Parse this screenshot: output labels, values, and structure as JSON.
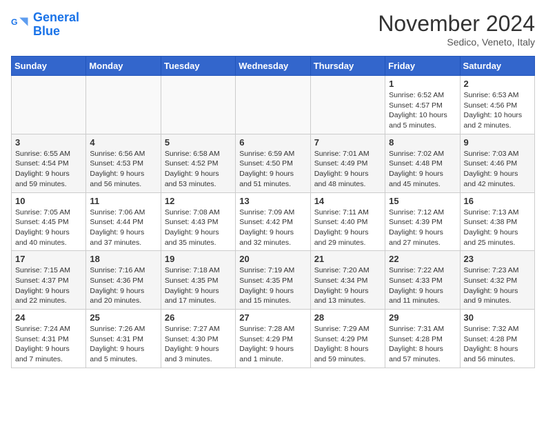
{
  "logo": {
    "line1": "General",
    "line2": "Blue"
  },
  "title": "November 2024",
  "location": "Sedico, Veneto, Italy",
  "headers": [
    "Sunday",
    "Monday",
    "Tuesday",
    "Wednesday",
    "Thursday",
    "Friday",
    "Saturday"
  ],
  "weeks": [
    [
      {
        "day": "",
        "info": ""
      },
      {
        "day": "",
        "info": ""
      },
      {
        "day": "",
        "info": ""
      },
      {
        "day": "",
        "info": ""
      },
      {
        "day": "",
        "info": ""
      },
      {
        "day": "1",
        "info": "Sunrise: 6:52 AM\nSunset: 4:57 PM\nDaylight: 10 hours\nand 5 minutes."
      },
      {
        "day": "2",
        "info": "Sunrise: 6:53 AM\nSunset: 4:56 PM\nDaylight: 10 hours\nand 2 minutes."
      }
    ],
    [
      {
        "day": "3",
        "info": "Sunrise: 6:55 AM\nSunset: 4:54 PM\nDaylight: 9 hours\nand 59 minutes."
      },
      {
        "day": "4",
        "info": "Sunrise: 6:56 AM\nSunset: 4:53 PM\nDaylight: 9 hours\nand 56 minutes."
      },
      {
        "day": "5",
        "info": "Sunrise: 6:58 AM\nSunset: 4:52 PM\nDaylight: 9 hours\nand 53 minutes."
      },
      {
        "day": "6",
        "info": "Sunrise: 6:59 AM\nSunset: 4:50 PM\nDaylight: 9 hours\nand 51 minutes."
      },
      {
        "day": "7",
        "info": "Sunrise: 7:01 AM\nSunset: 4:49 PM\nDaylight: 9 hours\nand 48 minutes."
      },
      {
        "day": "8",
        "info": "Sunrise: 7:02 AM\nSunset: 4:48 PM\nDaylight: 9 hours\nand 45 minutes."
      },
      {
        "day": "9",
        "info": "Sunrise: 7:03 AM\nSunset: 4:46 PM\nDaylight: 9 hours\nand 42 minutes."
      }
    ],
    [
      {
        "day": "10",
        "info": "Sunrise: 7:05 AM\nSunset: 4:45 PM\nDaylight: 9 hours\nand 40 minutes."
      },
      {
        "day": "11",
        "info": "Sunrise: 7:06 AM\nSunset: 4:44 PM\nDaylight: 9 hours\nand 37 minutes."
      },
      {
        "day": "12",
        "info": "Sunrise: 7:08 AM\nSunset: 4:43 PM\nDaylight: 9 hours\nand 35 minutes."
      },
      {
        "day": "13",
        "info": "Sunrise: 7:09 AM\nSunset: 4:42 PM\nDaylight: 9 hours\nand 32 minutes."
      },
      {
        "day": "14",
        "info": "Sunrise: 7:11 AM\nSunset: 4:40 PM\nDaylight: 9 hours\nand 29 minutes."
      },
      {
        "day": "15",
        "info": "Sunrise: 7:12 AM\nSunset: 4:39 PM\nDaylight: 9 hours\nand 27 minutes."
      },
      {
        "day": "16",
        "info": "Sunrise: 7:13 AM\nSunset: 4:38 PM\nDaylight: 9 hours\nand 25 minutes."
      }
    ],
    [
      {
        "day": "17",
        "info": "Sunrise: 7:15 AM\nSunset: 4:37 PM\nDaylight: 9 hours\nand 22 minutes."
      },
      {
        "day": "18",
        "info": "Sunrise: 7:16 AM\nSunset: 4:36 PM\nDaylight: 9 hours\nand 20 minutes."
      },
      {
        "day": "19",
        "info": "Sunrise: 7:18 AM\nSunset: 4:35 PM\nDaylight: 9 hours\nand 17 minutes."
      },
      {
        "day": "20",
        "info": "Sunrise: 7:19 AM\nSunset: 4:35 PM\nDaylight: 9 hours\nand 15 minutes."
      },
      {
        "day": "21",
        "info": "Sunrise: 7:20 AM\nSunset: 4:34 PM\nDaylight: 9 hours\nand 13 minutes."
      },
      {
        "day": "22",
        "info": "Sunrise: 7:22 AM\nSunset: 4:33 PM\nDaylight: 9 hours\nand 11 minutes."
      },
      {
        "day": "23",
        "info": "Sunrise: 7:23 AM\nSunset: 4:32 PM\nDaylight: 9 hours\nand 9 minutes."
      }
    ],
    [
      {
        "day": "24",
        "info": "Sunrise: 7:24 AM\nSunset: 4:31 PM\nDaylight: 9 hours\nand 7 minutes."
      },
      {
        "day": "25",
        "info": "Sunrise: 7:26 AM\nSunset: 4:31 PM\nDaylight: 9 hours\nand 5 minutes."
      },
      {
        "day": "26",
        "info": "Sunrise: 7:27 AM\nSunset: 4:30 PM\nDaylight: 9 hours\nand 3 minutes."
      },
      {
        "day": "27",
        "info": "Sunrise: 7:28 AM\nSunset: 4:29 PM\nDaylight: 9 hours\nand 1 minute."
      },
      {
        "day": "28",
        "info": "Sunrise: 7:29 AM\nSunset: 4:29 PM\nDaylight: 8 hours\nand 59 minutes."
      },
      {
        "day": "29",
        "info": "Sunrise: 7:31 AM\nSunset: 4:28 PM\nDaylight: 8 hours\nand 57 minutes."
      },
      {
        "day": "30",
        "info": "Sunrise: 7:32 AM\nSunset: 4:28 PM\nDaylight: 8 hours\nand 56 minutes."
      }
    ]
  ]
}
